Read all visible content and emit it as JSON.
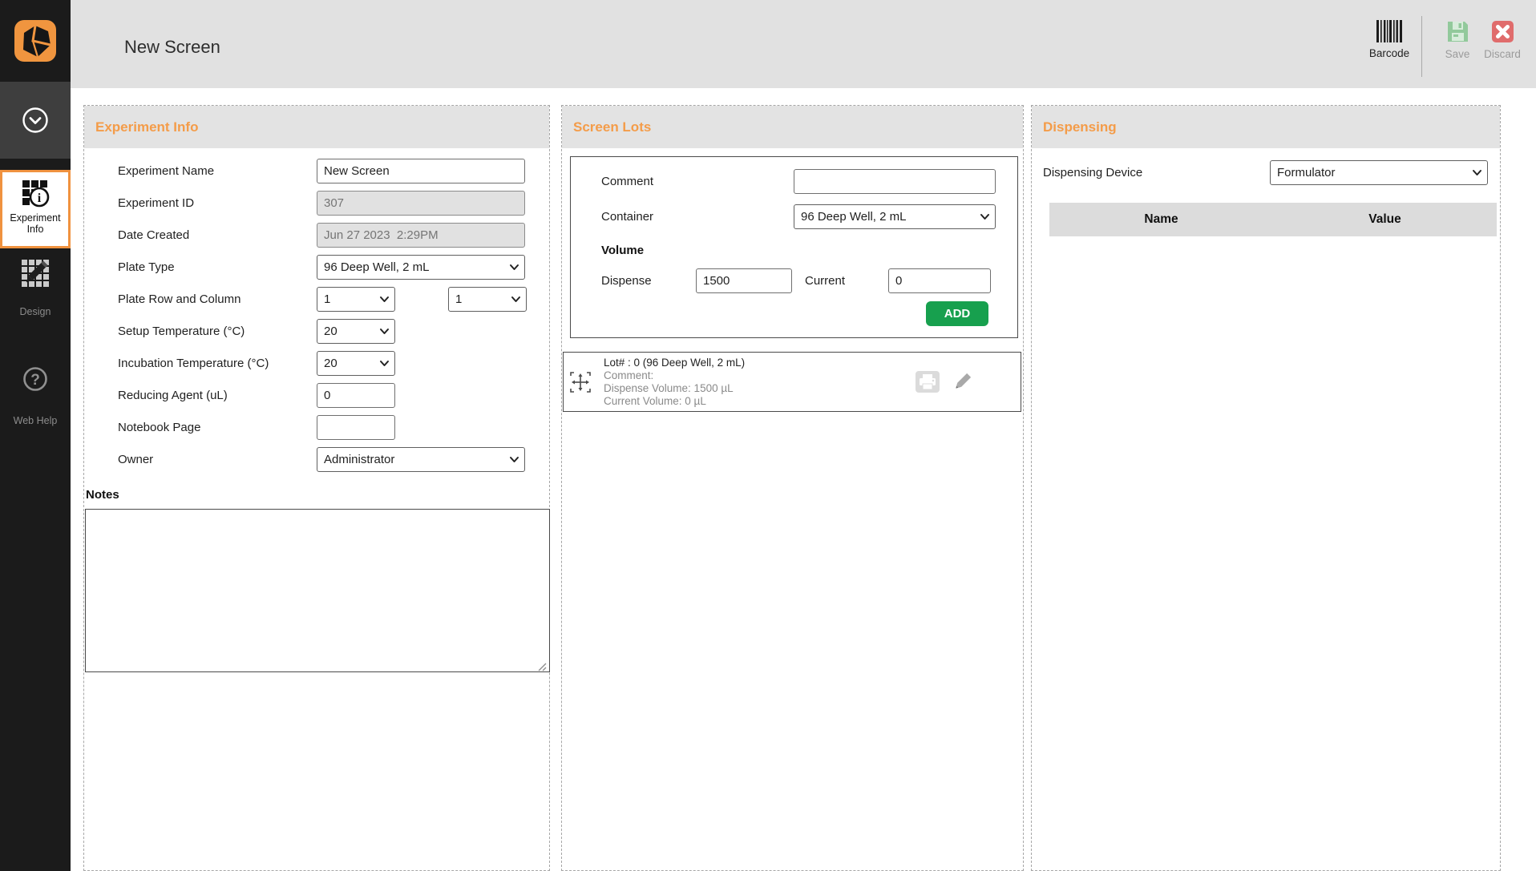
{
  "topbar": {
    "title": "New Screen",
    "actions": {
      "barcode": "Barcode",
      "save": "Save",
      "discard": "Discard"
    }
  },
  "sidebar": {
    "items": [
      {
        "label": "Experiment Info"
      },
      {
        "label": "Design"
      },
      {
        "label": "Web Help"
      }
    ]
  },
  "colors": {
    "accent_orange": "#f0923f",
    "add_green": "#17a04e",
    "discard_red": "#e06c6c"
  },
  "experiment_info": {
    "title": "Experiment Info",
    "fields": {
      "experiment_name": {
        "label": "Experiment Name",
        "value": "New Screen"
      },
      "experiment_id": {
        "label": "Experiment ID",
        "value": "307"
      },
      "date_created": {
        "label": "Date Created",
        "value": "Jun 27 2023  2:29PM"
      },
      "plate_type": {
        "label": "Plate Type",
        "value": "96 Deep Well, 2 mL"
      },
      "plate_row_col": {
        "label": "Plate Row and Column",
        "row": "1",
        "col": "1"
      },
      "setup_temp": {
        "label": "Setup Temperature (°C)",
        "value": "20"
      },
      "incubation_temp": {
        "label": "Incubation Temperature (°C)",
        "value": "20"
      },
      "reducing_agent": {
        "label": "Reducing Agent (uL)",
        "value": "0"
      },
      "notebook_page": {
        "label": "Notebook Page",
        "value": ""
      },
      "owner": {
        "label": "Owner",
        "value": "Administrator"
      },
      "notes": {
        "label": "Notes",
        "value": ""
      }
    }
  },
  "screen_lots": {
    "title": "Screen Lots",
    "comment": {
      "label": "Comment",
      "value": ""
    },
    "container": {
      "label": "Container",
      "value": "96 Deep Well, 2 mL"
    },
    "volume_label": "Volume",
    "dispense": {
      "label": "Dispense",
      "value": "1500"
    },
    "current": {
      "label": "Current",
      "value": "0"
    },
    "add_label": "ADD",
    "lots": [
      {
        "title": "Lot# : 0 (96 Deep Well, 2 mL)",
        "comment": "Comment:",
        "dispense_volume": "Dispense Volume: 1500 µL",
        "current_volume": "Current Volume: 0 µL"
      }
    ]
  },
  "dispensing": {
    "title": "Dispensing",
    "device": {
      "label": "Dispensing Device",
      "value": "Formulator"
    },
    "table": {
      "columns": [
        "Name",
        "Value"
      ]
    }
  }
}
